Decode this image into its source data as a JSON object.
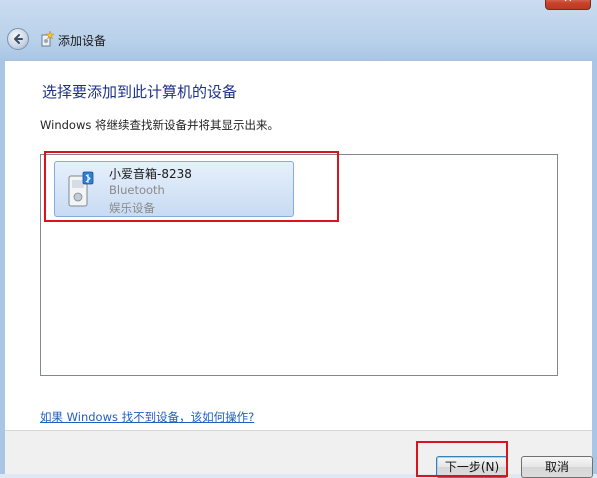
{
  "window": {
    "close_label": "✕",
    "title": "添加设备"
  },
  "content": {
    "heading": "选择要添加到此计算机的设备",
    "info": "Windows 将继续查找新设备并将其显示出来。",
    "devices": [
      {
        "name": "小爱音箱-8238",
        "type": "Bluetooth",
        "category": "娱乐设备",
        "icon": "speaker-icon"
      }
    ],
    "help_link": "如果 Windows 找不到设备，该如何操作?"
  },
  "footer": {
    "next_label": "下一步(N)",
    "cancel_label": "取消"
  },
  "colors": {
    "heading": "#1e3287",
    "highlight": "#d8141c",
    "link": "#1f5fbf"
  }
}
